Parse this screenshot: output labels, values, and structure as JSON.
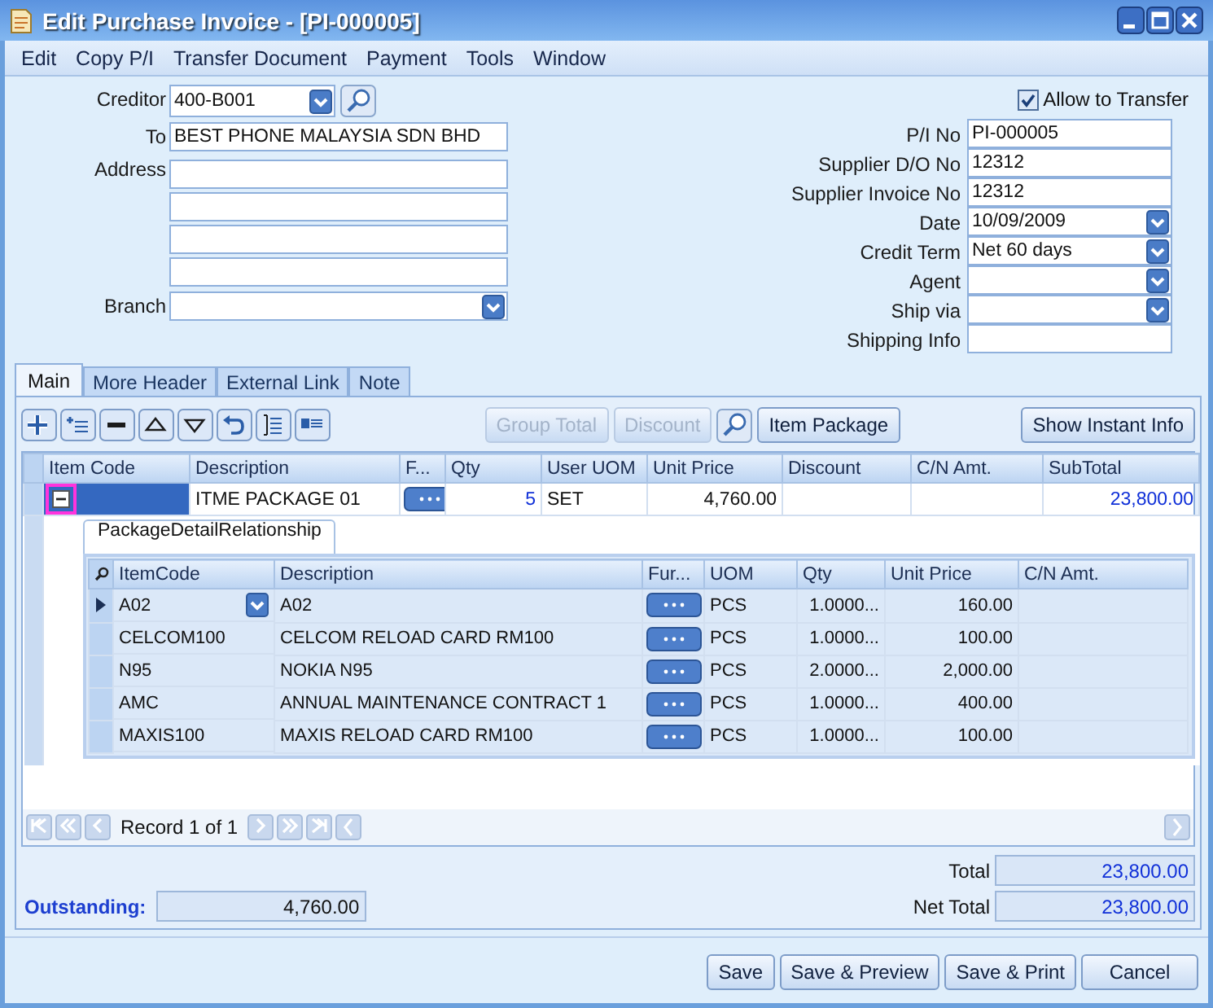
{
  "window": {
    "title": "Edit Purchase Invoice - [PI-000005]"
  },
  "menu": [
    "Edit",
    "Copy P/I",
    "Transfer Document",
    "Payment",
    "Tools",
    "Window"
  ],
  "allow_transfer": {
    "label": "Allow to Transfer",
    "checked": true
  },
  "left_fields": [
    {
      "kind": "lookup",
      "label": "Creditor",
      "value": "400-B001"
    },
    {
      "kind": "text",
      "label": "To",
      "value": "BEST PHONE MALAYSIA SDN BHD"
    },
    {
      "kind": "address",
      "label": "Address"
    },
    {
      "kind": "dropdown",
      "label": "Branch"
    }
  ],
  "right_fields": [
    {
      "kind": "text",
      "label": "P/I  No",
      "value": "PI-000005"
    },
    {
      "kind": "text",
      "label": "Supplier D/O No",
      "value": "12312"
    },
    {
      "kind": "text",
      "label": "Supplier Invoice No",
      "value": "12312"
    },
    {
      "kind": "dropdown",
      "label": "Date",
      "value": "10/09/2009"
    },
    {
      "kind": "dropdown",
      "label": "Credit Term",
      "value": "Net 60 days"
    },
    {
      "kind": "dropdown",
      "label": "Agent"
    },
    {
      "kind": "dropdown",
      "label": "Ship via"
    },
    {
      "kind": "text",
      "label": "Shipping Info"
    }
  ],
  "tabs": [
    {
      "label": "Main",
      "selected": true
    },
    {
      "label": "More Header",
      "selected": false
    },
    {
      "label": "External Link",
      "selected": false
    },
    {
      "label": "Note",
      "selected": false
    }
  ],
  "toolbar_buttons": [
    {
      "label": "Group Total",
      "disabled": true
    },
    {
      "label": "Discount",
      "disabled": true
    },
    {
      "label": "Item Package",
      "disabled": false
    }
  ],
  "instant_info_button": "Show Instant Info",
  "grid": {
    "columns": [
      "Item Code",
      "Description",
      "F...",
      "Qty",
      "User UOM",
      "Unit Price",
      "Discount",
      "C/N Amt.",
      "SubTotal"
    ],
    "rows": [
      {
        "selected": true,
        "expanded": true,
        "description": "ITME PACKAGE 01",
        "qty": "5",
        "uom": "SET",
        "unit_price": "4,760.00",
        "subtotal": "23,800.00"
      }
    ]
  },
  "detail_tab": "PackageDetailRelationship",
  "detail_grid": {
    "columns": [
      "ItemCode",
      "Description",
      "Fur...",
      "UOM",
      "Qty",
      "Unit Price",
      "C/N Amt."
    ],
    "rows": [
      {
        "selected": true,
        "item_code": "A02",
        "description": "A02",
        "uom": "PCS",
        "qty": "1.0000...",
        "unit_price": "160.00"
      },
      {
        "selected": false,
        "item_code": "CELCOM100",
        "description": "CELCOM RELOAD CARD RM100",
        "uom": "PCS",
        "qty": "1.0000...",
        "unit_price": "100.00"
      },
      {
        "selected": false,
        "item_code": "N95",
        "description": "NOKIA N95",
        "uom": "PCS",
        "qty": "2.0000...",
        "unit_price": "2,000.00"
      },
      {
        "selected": false,
        "item_code": "AMC",
        "description": "ANNUAL MAINTENANCE CONTRACT 1",
        "uom": "PCS",
        "qty": "1.0000...",
        "unit_price": "400.00"
      },
      {
        "selected": false,
        "item_code": "MAXIS100",
        "description": "MAXIS RELOAD CARD RM100",
        "uom": "PCS",
        "qty": "1.0000...",
        "unit_price": "100.00"
      }
    ]
  },
  "navigator": "Record 1 of 1",
  "outstanding": {
    "label": "Outstanding:",
    "value": "4,760.00"
  },
  "totals": [
    {
      "label": "Total",
      "value": "23,800.00"
    },
    {
      "label": "Net Total",
      "value": "23,800.00"
    }
  ],
  "buttons": [
    "Save",
    "Save & Preview",
    "Save & Print",
    "Cancel"
  ]
}
